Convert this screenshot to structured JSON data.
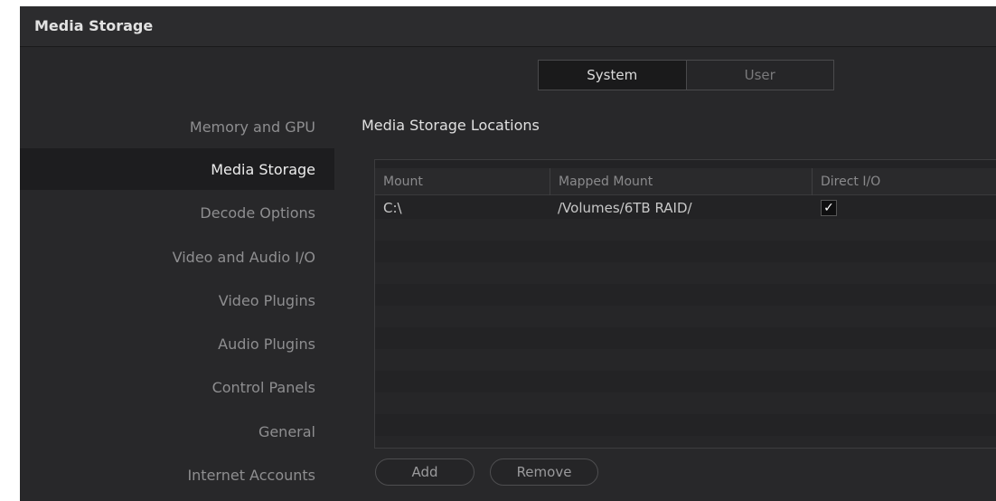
{
  "window": {
    "title": "Media Storage"
  },
  "segment": {
    "system_label": "System",
    "user_label": "User",
    "selected": "System"
  },
  "sidebar": {
    "items": [
      {
        "label": "Memory and GPU",
        "active": false
      },
      {
        "label": "Media Storage",
        "active": true
      },
      {
        "label": "Decode Options",
        "active": false
      },
      {
        "label": "Video and Audio I/O",
        "active": false
      },
      {
        "label": "Video Plugins",
        "active": false
      },
      {
        "label": "Audio Plugins",
        "active": false
      },
      {
        "label": "Control Panels",
        "active": false
      },
      {
        "label": "General",
        "active": false
      },
      {
        "label": "Internet Accounts",
        "active": false
      }
    ]
  },
  "main": {
    "section_title": "Media Storage Locations",
    "table": {
      "columns": [
        "Mount",
        "Mapped Mount",
        "Direct I/O"
      ],
      "rows": [
        {
          "mount": "C:\\",
          "mapped": "/Volumes/6TB RAID/",
          "direct_io": true
        }
      ]
    },
    "buttons": {
      "add_label": "Add",
      "remove_label": "Remove"
    }
  },
  "colors": {
    "background": "#28282a",
    "active_sidebar": "#1d1d1f",
    "text_primary": "#e0e0e0",
    "text_muted": "#8e8e90"
  }
}
